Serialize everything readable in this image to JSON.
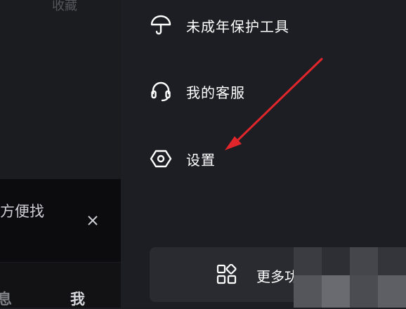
{
  "left": {
    "top_partial_label": "收藏",
    "toast_text": "方便找",
    "nav_partial_1": "息",
    "nav_partial_2": "我"
  },
  "menu": [
    {
      "label": "未成年保护工具",
      "icon": "umbrella-icon"
    },
    {
      "label": "我的客服",
      "icon": "headset-icon"
    },
    {
      "label": "设置",
      "icon": "settings-hexagon-icon"
    }
  ],
  "more_button": {
    "label": "更多功",
    "icon": "apps-grid-icon"
  },
  "colors": {
    "annotation_arrow": "#e0262b",
    "panel_bg": "#1d1e23",
    "button_bg": "#2a2b31"
  }
}
